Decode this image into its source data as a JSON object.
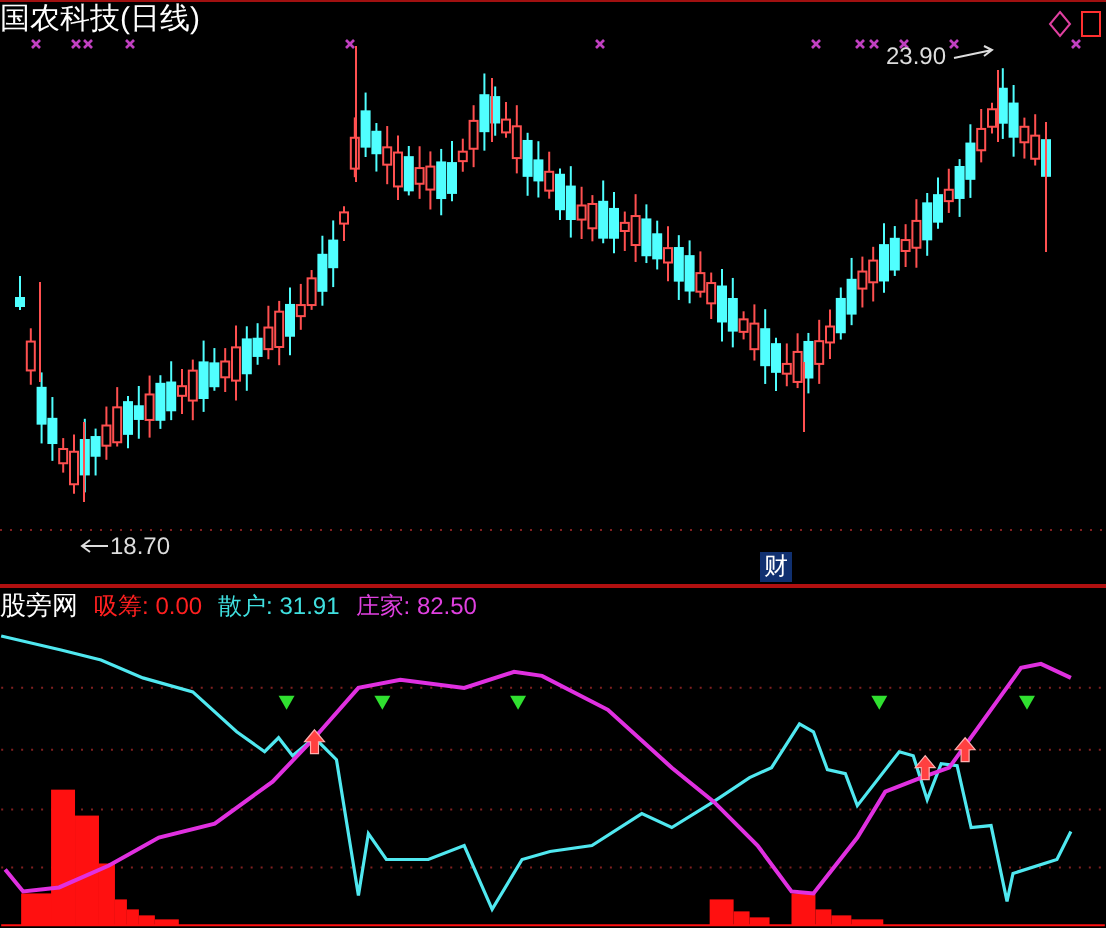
{
  "title": "国农科技(日线)",
  "price_marks": {
    "high": "23.90",
    "low": "18.70",
    "event": "财"
  },
  "indicator": {
    "name": "股旁网",
    "readings": [
      {
        "label": "吸筹:",
        "value": "0.00",
        "color": "#ff2020"
      },
      {
        "label": "散户:",
        "value": "31.91",
        "color": "#40e0e0"
      },
      {
        "label": "庄家:",
        "value": "82.50",
        "color": "#e040e0"
      }
    ]
  }
}
